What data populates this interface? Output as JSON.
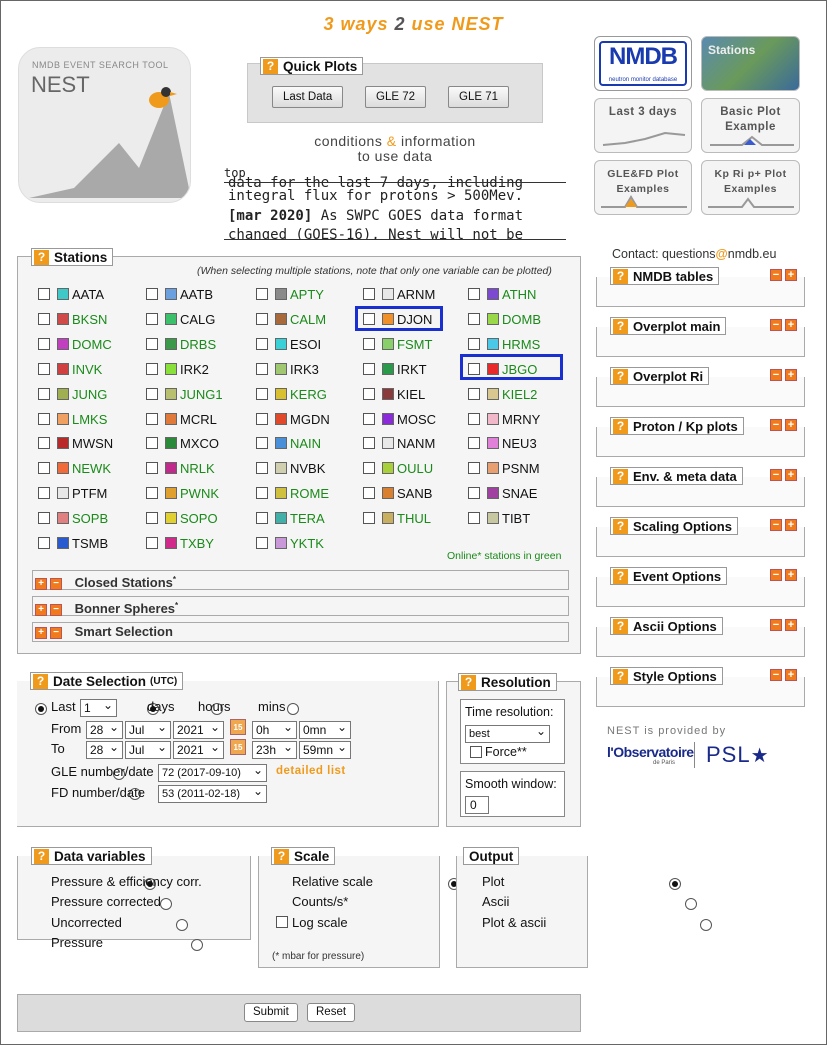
{
  "header": {
    "headline_part1": "3 ways",
    "headline_part2": "2",
    "headline_part3": "use NEST",
    "logo_small": "NMDB EVENT SEARCH TOOL",
    "logo_big": "NEST"
  },
  "quick_plots": {
    "title": "Quick Plots",
    "buttons": [
      "Last Data",
      "GLE 72",
      "GLE 71"
    ]
  },
  "conditions": {
    "part1": "conditions",
    "amp": "&",
    "part2": "information",
    "line2": "to use data"
  },
  "news": {
    "top_label": "top",
    "line1": "data for the last 7 days, including",
    "line2": "integral flux for protons > 500Mev.",
    "line3_bold": "[mar 2020]",
    "line3_rest": " As SWPC GOES data format",
    "line4": "changed (GOES-16), Nest will not be"
  },
  "tiles": {
    "nmdb_logo": "NMDB",
    "nmdb_sub": "neutron monitor database",
    "stations": "Stations",
    "last3": "Last 3 days",
    "basic_plot": "Basic Plot Example",
    "gle_fd": "GLE&FD Plot Examples",
    "kp_plot": "Kp Ri p+ Plot Examples"
  },
  "contact": {
    "prefix": "Contact: questions",
    "at": "@",
    "suffix": "nmdb.eu"
  },
  "right_panels": [
    "NMDB tables",
    "Overplot main",
    "Overplot Ri",
    "Proton / Kp plots",
    "Env. & meta data",
    "Scaling Options",
    "Event Options",
    "Ascii Options",
    "Style Options"
  ],
  "stations": {
    "title": "Stations",
    "note": "(When selecting multiple stations, note that only one variable can be plotted)",
    "online_note": "Online* stations in green",
    "rows": [
      [
        {
          "n": "AATA",
          "c": "#3fc8c8",
          "on": false
        },
        {
          "n": "AATB",
          "c": "#6aa0e0",
          "on": false
        },
        {
          "n": "APTY",
          "c": "#8a8a8a",
          "on": true
        },
        {
          "n": "ARNM",
          "c": "#e8e8e8",
          "on": false
        },
        {
          "n": "ATHN",
          "c": "#7c4ad0",
          "on": true
        }
      ],
      [
        {
          "n": "BKSN",
          "c": "#d04a4a",
          "on": true
        },
        {
          "n": "CALG",
          "c": "#3cc06c",
          "on": false
        },
        {
          "n": "CALM",
          "c": "#a86a3a",
          "on": true
        },
        {
          "n": "DJON",
          "c": "#f0902a",
          "on": false
        },
        {
          "n": "DOMB",
          "c": "#9ad84a",
          "on": true
        }
      ],
      [
        {
          "n": "DOMC",
          "c": "#c040c0",
          "on": true
        },
        {
          "n": "DRBS",
          "c": "#3a9a4a",
          "on": true
        },
        {
          "n": "ESOI",
          "c": "#3ad0d8",
          "on": false
        },
        {
          "n": "FSMT",
          "c": "#8ad06a",
          "on": true
        },
        {
          "n": "HRMS",
          "c": "#4ac8e8",
          "on": true
        }
      ],
      [
        {
          "n": "INVK",
          "c": "#d04040",
          "on": true
        },
        {
          "n": "IRK2",
          "c": "#8ae03a",
          "on": false
        },
        {
          "n": "IRK3",
          "c": "#a0c870",
          "on": false
        },
        {
          "n": "IRKT",
          "c": "#2a9a4a",
          "on": false
        },
        {
          "n": "JBGO",
          "c": "#e82a2a",
          "on": true
        }
      ],
      [
        {
          "n": "JUNG",
          "c": "#a0b050",
          "on": true
        },
        {
          "n": "JUNG1",
          "c": "#b8c070",
          "on": true
        },
        {
          "n": "KERG",
          "c": "#d8c030",
          "on": true
        },
        {
          "n": "KIEL",
          "c": "#8a3a3a",
          "on": false
        },
        {
          "n": "KIEL2",
          "c": "#d8c890",
          "on": true
        }
      ],
      [
        {
          "n": "LMKS",
          "c": "#f0a060",
          "on": true
        },
        {
          "n": "MCRL",
          "c": "#e07a3a",
          "on": false
        },
        {
          "n": "MGDN",
          "c": "#e04a2a",
          "on": false
        },
        {
          "n": "MOSC",
          "c": "#8a2ad8",
          "on": false
        },
        {
          "n": "MRNY",
          "c": "#f0b8c8",
          "on": false
        }
      ],
      [
        {
          "n": "MWSN",
          "c": "#b82a2a",
          "on": false
        },
        {
          "n": "MXCO",
          "c": "#2a8a3a",
          "on": false
        },
        {
          "n": "NAIN",
          "c": "#4a90d8",
          "on": true
        },
        {
          "n": "NANM",
          "c": "#e8e8e8",
          "on": false
        },
        {
          "n": "NEU3",
          "c": "#e080d8",
          "on": false
        }
      ],
      [
        {
          "n": "NEWK",
          "c": "#f06a3a",
          "on": true
        },
        {
          "n": "NRLK",
          "c": "#c02a8a",
          "on": true
        },
        {
          "n": "NVBK",
          "c": "#d0d0b0",
          "on": false
        },
        {
          "n": "OULU",
          "c": "#a8d03a",
          "on": true
        },
        {
          "n": "PSNM",
          "c": "#e8a070",
          "on": false
        }
      ],
      [
        {
          "n": "PTFM",
          "c": "#e8e8e8",
          "on": false
        },
        {
          "n": "PWNK",
          "c": "#e0a030",
          "on": true
        },
        {
          "n": "ROME",
          "c": "#d0c040",
          "on": true
        },
        {
          "n": "SANB",
          "c": "#d88030",
          "on": false
        },
        {
          "n": "SNAE",
          "c": "#a040a0",
          "on": false
        }
      ],
      [
        {
          "n": "SOPB",
          "c": "#e08080",
          "on": true
        },
        {
          "n": "SOPO",
          "c": "#e0d030",
          "on": true
        },
        {
          "n": "TERA",
          "c": "#40b0a8",
          "on": true
        },
        {
          "n": "THUL",
          "c": "#c8b060",
          "on": true
        },
        {
          "n": "TIBT",
          "c": "#c8c8a0",
          "on": false
        }
      ],
      [
        {
          "n": "TSMB",
          "c": "#2a5ad0",
          "on": false
        },
        {
          "n": "TXBY",
          "c": "#d02a8a",
          "on": true
        },
        {
          "n": "YKTK",
          "c": "#c898d8",
          "on": true
        }
      ]
    ],
    "sub_panels": [
      "Closed Stations",
      "Bonner Spheres",
      "Smart Selection"
    ]
  },
  "date_selection": {
    "title": "Date Selection",
    "utc": "(UTC)",
    "last_label": "Last",
    "last_value": "1",
    "days": "days",
    "hours": "hours",
    "mins": "mins",
    "from_label": "From",
    "to_label": "To",
    "from": {
      "day": "28",
      "month": "Jul",
      "year": "2021",
      "hour": "0h",
      "min": "0mn"
    },
    "to": {
      "day": "28",
      "month": "Jul",
      "year": "2021",
      "hour": "23h",
      "min": "59mn"
    },
    "gle_label": "GLE number/date",
    "gle_value": "72 (2017-09-10)",
    "detailed": "detailed list",
    "fd_label": "FD number/date",
    "fd_value": "53 (2011-02-18)"
  },
  "resolution": {
    "title": "Resolution",
    "time_res_label": "Time resolution:",
    "time_res_value": "best",
    "force": "Force**",
    "smooth_label": "Smooth window:",
    "smooth_value": "0"
  },
  "provided": {
    "text": "NEST is provided by",
    "obs": "l'Observatoire",
    "obs_sub": "de Paris",
    "psl": "PSL"
  },
  "data_variables": {
    "title": "Data variables",
    "options": [
      "Pressure & efficiency corr.",
      "Pressure corrected",
      "Uncorrected",
      "Pressure"
    ]
  },
  "scale": {
    "title": "Scale",
    "options": [
      "Relative scale",
      "Counts/s*"
    ],
    "log": "Log scale",
    "note": "(* mbar for pressure)"
  },
  "output": {
    "title": "Output",
    "options": [
      "Plot",
      "Ascii",
      "Plot & ascii"
    ]
  },
  "actions": {
    "submit": "Submit",
    "reset": "Reset"
  }
}
